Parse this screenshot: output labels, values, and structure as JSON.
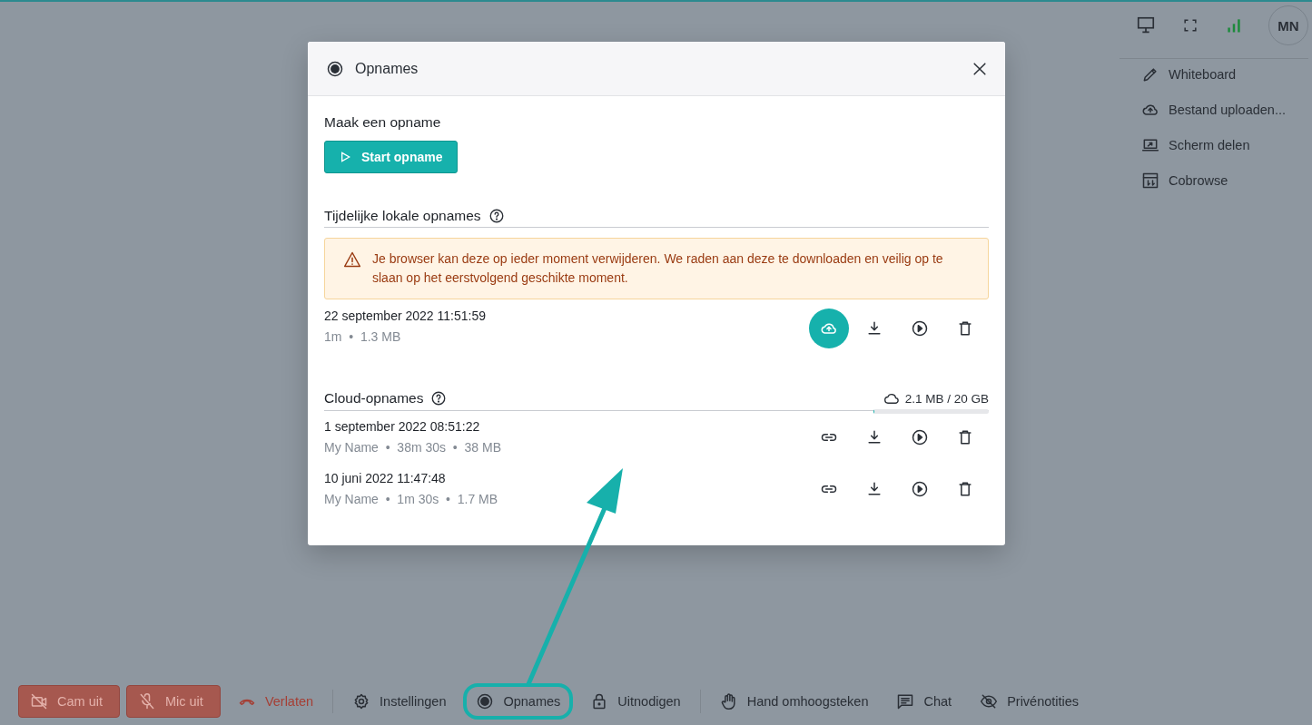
{
  "top_bar": {
    "avatar": "MN"
  },
  "side_menu": [
    {
      "label": "Whiteboard"
    },
    {
      "label": "Bestand uploaden..."
    },
    {
      "label": "Scherm delen"
    },
    {
      "label": "Cobrowse"
    }
  ],
  "dialog": {
    "title": "Opnames",
    "make_heading": "Maak een opname",
    "start_button": "Start opname",
    "local": {
      "heading": "Tijdelijke lokale opnames",
      "warning": "Je browser kan deze op ieder moment verwijderen. We raden aan deze te downloaden en veilig op te slaan op het eerstvolgend geschikte moment.",
      "recordings": [
        {
          "date": "22 september 2022 11:51:59",
          "meta": "1m  •  1.3 MB"
        }
      ]
    },
    "cloud": {
      "heading": "Cloud-opnames",
      "storage": "2.1 MB / 20 GB",
      "level": 0.001,
      "recordings": [
        {
          "date": "1 september 2022 08:51:22",
          "meta": "My Name  •  38m 30s  •  38 MB"
        },
        {
          "date": "10 juni 2022 11:47:48",
          "meta": "My Name  •  1m 30s  •  1.7 MB"
        }
      ]
    }
  },
  "toolbar": [
    {
      "kind": "danger-button",
      "label": "Cam uit"
    },
    {
      "kind": "danger-button",
      "label": "Mic uit"
    },
    {
      "kind": "danger-link",
      "label": "Verlaten"
    },
    {
      "kind": "divider"
    },
    {
      "kind": "item",
      "label": "Instellingen",
      "highlighted": false
    },
    {
      "kind": "item",
      "label": "Opnames",
      "highlighted": true
    },
    {
      "kind": "item",
      "label": "Uitnodigen",
      "highlighted": false
    },
    {
      "kind": "divider"
    },
    {
      "kind": "item",
      "label": "Hand omhoogsteken",
      "highlighted": false
    },
    {
      "kind": "item",
      "label": "Chat",
      "highlighted": false
    },
    {
      "kind": "item",
      "label": "Privénotities",
      "highlighted": false
    }
  ]
}
